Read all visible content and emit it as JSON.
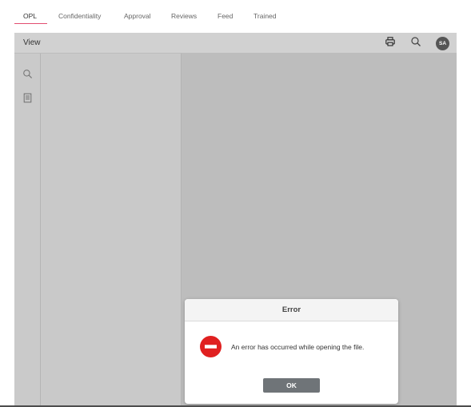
{
  "tabs": [
    {
      "label": "OPL",
      "active": true
    },
    {
      "label": "Confidentiality",
      "active": false
    },
    {
      "label": "Approval",
      "active": false
    },
    {
      "label": "Reviews",
      "active": false
    },
    {
      "label": "Feed",
      "active": false
    },
    {
      "label": "Trained",
      "active": false
    }
  ],
  "toolbar": {
    "title": "View",
    "print_icon": "print-icon",
    "search_icon": "search-icon",
    "avatar_initials": "SA"
  },
  "left_rail": {
    "icons": [
      "search-icon",
      "document-icon"
    ]
  },
  "dialog": {
    "title": "Error",
    "icon": "error-stop-icon",
    "message": "An error has occurred while opening the file.",
    "ok_label": "OK"
  },
  "colors": {
    "active_tab_underline": "#e24d70",
    "error_red": "#e02020",
    "ok_button": "#6f7478",
    "viewer_background": "#c8c8c8",
    "document_area": "#bdbdbd"
  }
}
